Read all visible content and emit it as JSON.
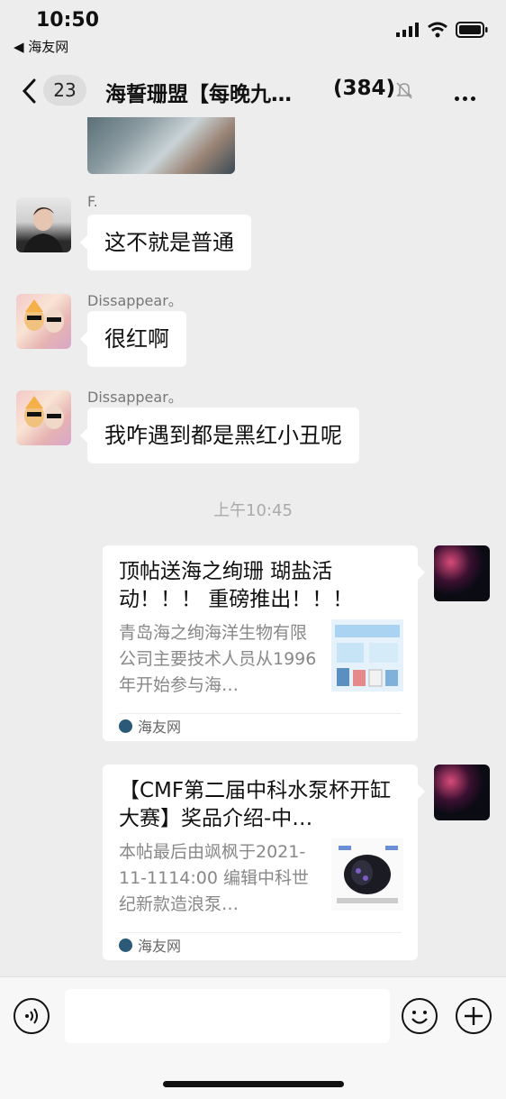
{
  "status_bar": {
    "time": "10:50",
    "back_app": "◀ 海友网"
  },
  "nav": {
    "unread_badge": "23",
    "title": "海誓珊盟【每晚九…",
    "member_count": "(384)"
  },
  "messages": [
    {
      "sender": "F.",
      "text": "这不就是普通"
    },
    {
      "sender": "Dissappear。",
      "text": "很红啊"
    },
    {
      "sender": "Dissappear。",
      "text": "我咋遇到都是黑红小丑呢"
    }
  ],
  "time_separator": "上午10:45",
  "cards": [
    {
      "title": "顶帖送海之绚珊 瑚盐活动！！！ 重磅推出！！！",
      "description": "青岛海之绚海洋生物有限公司主要技术人员从1996年开始参与海…",
      "source": "海友网"
    },
    {
      "title": "【CMF第二届中科水泵杯开缸大赛】奖品介绍-中…",
      "description": "本帖最后由飒枫于2021-11-1114:00 编辑中科世纪新款造浪泵…",
      "source": "海友网"
    }
  ],
  "icons": [
    "back-chevron-icon",
    "mute-icon",
    "more-icon",
    "voice-icon",
    "emoji-icon",
    "plus-icon",
    "signal-icon",
    "wifi-icon",
    "battery-icon"
  ]
}
